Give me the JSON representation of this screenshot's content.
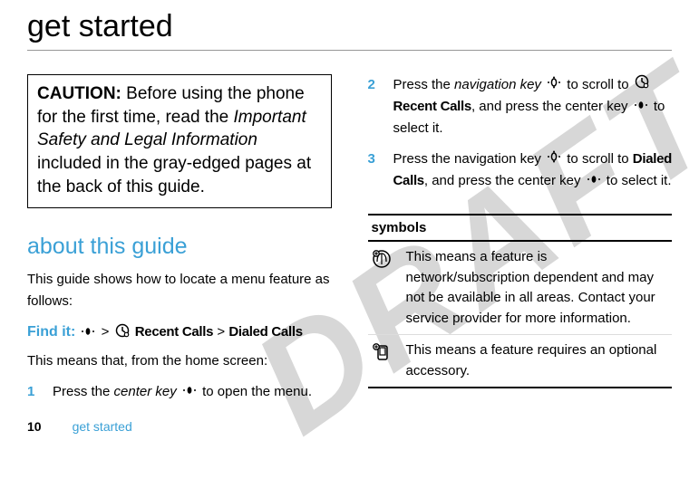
{
  "title": "get started",
  "watermark": "DRAFT",
  "caution": {
    "label": "CAUTION:",
    "before": " Before using the phone for the first time, read the ",
    "italic": "Important Safety and Legal Information",
    "after": " included in the gray-edged pages at the back of this guide."
  },
  "section_heading": "about this guide",
  "guide_intro": "This guide shows how to locate a menu feature as follows:",
  "findit": {
    "label": "Find it:",
    "sep": " > ",
    "item1": "Recent Calls",
    "item2": "Dialed Calls"
  },
  "means_intro": "This means that, from the home screen:",
  "steps": {
    "s1": {
      "num": "1",
      "a": "Press the ",
      "ital": "center key",
      "b": " to open the menu."
    },
    "s2": {
      "num": "2",
      "a": "Press the ",
      "ital": "navigation key",
      "b": " to scroll to ",
      "item": "Recent Calls",
      "c": ", and press the center key ",
      "d": " to select it."
    },
    "s3": {
      "num": "3",
      "a": "Press the navigation key ",
      "b": " to scroll to ",
      "item": "Dialed Calls",
      "c": ", and press the center key ",
      "d": " to select it."
    }
  },
  "symbols": {
    "header": "symbols",
    "row1": "This means a feature is network/subscription dependent and may not be available in all areas. Contact your service provider for more information.",
    "row2": "This means a feature requires an optional accessory."
  },
  "footer": {
    "page": "10",
    "title": "get started"
  }
}
